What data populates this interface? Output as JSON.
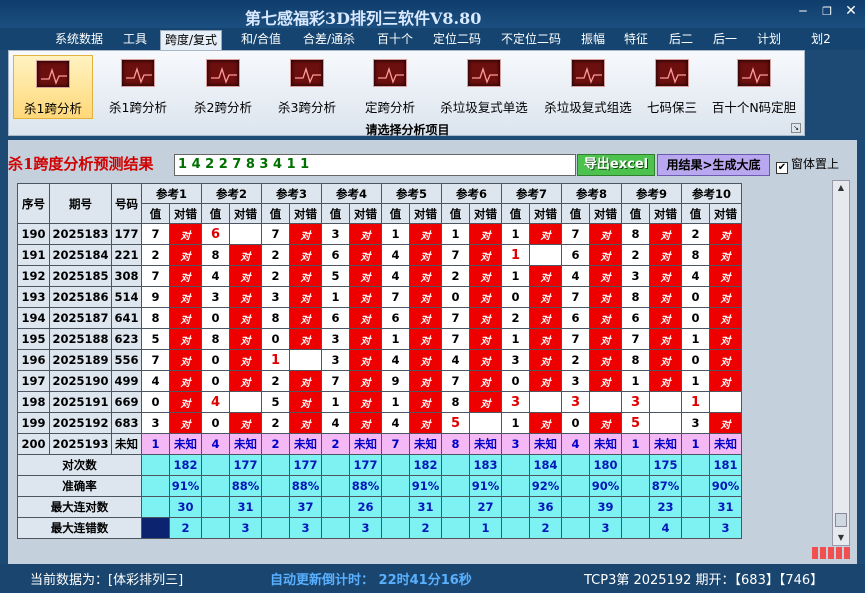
{
  "window": {
    "title": "第七感福彩3D排列三软件V8.80"
  },
  "menu": [
    "系统数据",
    "工具",
    "跨度/复式",
    "和/合值",
    "合差/通杀",
    "百十个",
    "定位二码",
    "不定位二码",
    "振幅",
    "特征",
    "后二",
    "后一",
    "计划",
    "划2"
  ],
  "menu_active_index": 2,
  "ribbon": {
    "items": [
      "杀1跨分析",
      "杀1跨分析",
      "杀2跨分析",
      "杀3跨分析",
      "定跨分析",
      "杀垃圾复式单选",
      "杀垃圾复式组选",
      "七码保三",
      "百十个N码定胆"
    ],
    "selected_index": 0,
    "caption": "请选择分析项目"
  },
  "result": {
    "heading": "杀1跨度分析预测结果",
    "values": "1 4 2 2 7 8 3 4 1 1",
    "excel_button": "导出excel",
    "generate_button": "用结果>生成大底",
    "topmost_label": "窗体置上",
    "topmost_checked": true
  },
  "table": {
    "col_headers": [
      "序号",
      "期号",
      "号码"
    ],
    "ref_headers": [
      "参考1",
      "参考2",
      "参考3",
      "参考4",
      "参考5",
      "参考6",
      "参考7",
      "参考8",
      "参考9",
      "参考10"
    ],
    "sub_headers": [
      "值",
      "对错"
    ],
    "rows": [
      {
        "seq": "190",
        "period": "2025183",
        "num": "177",
        "vals": [
          "7",
          "6",
          "7",
          "3",
          "1",
          "1",
          "1",
          "7",
          "8",
          "2"
        ],
        "hits": [
          1,
          0,
          1,
          1,
          1,
          1,
          1,
          1,
          1,
          1
        ]
      },
      {
        "seq": "191",
        "period": "2025184",
        "num": "221",
        "vals": [
          "2",
          "8",
          "2",
          "6",
          "4",
          "7",
          "1",
          "6",
          "2",
          "8"
        ],
        "hits": [
          1,
          1,
          1,
          1,
          1,
          1,
          0,
          1,
          1,
          1
        ]
      },
      {
        "seq": "192",
        "period": "2025185",
        "num": "308",
        "vals": [
          "7",
          "4",
          "2",
          "5",
          "4",
          "2",
          "1",
          "4",
          "3",
          "4"
        ],
        "hits": [
          1,
          1,
          1,
          1,
          1,
          1,
          1,
          1,
          1,
          1
        ]
      },
      {
        "seq": "193",
        "period": "2025186",
        "num": "514",
        "vals": [
          "9",
          "3",
          "3",
          "1",
          "7",
          "0",
          "0",
          "7",
          "8",
          "0"
        ],
        "hits": [
          1,
          1,
          1,
          1,
          1,
          1,
          1,
          1,
          1,
          1
        ]
      },
      {
        "seq": "194",
        "period": "2025187",
        "num": "641",
        "vals": [
          "8",
          "0",
          "8",
          "6",
          "6",
          "7",
          "2",
          "6",
          "6",
          "0"
        ],
        "hits": [
          1,
          1,
          1,
          1,
          1,
          1,
          1,
          1,
          1,
          1
        ]
      },
      {
        "seq": "195",
        "period": "2025188",
        "num": "623",
        "vals": [
          "5",
          "8",
          "0",
          "3",
          "1",
          "7",
          "1",
          "7",
          "7",
          "1"
        ],
        "hits": [
          1,
          1,
          1,
          1,
          1,
          1,
          1,
          1,
          1,
          1
        ]
      },
      {
        "seq": "196",
        "period": "2025189",
        "num": "556",
        "vals": [
          "7",
          "0",
          "1",
          "3",
          "4",
          "4",
          "3",
          "2",
          "8",
          "0"
        ],
        "hits": [
          1,
          1,
          0,
          1,
          1,
          1,
          1,
          1,
          1,
          1
        ]
      },
      {
        "seq": "197",
        "period": "2025190",
        "num": "499",
        "vals": [
          "4",
          "0",
          "2",
          "7",
          "9",
          "7",
          "0",
          "3",
          "1",
          "1"
        ],
        "hits": [
          1,
          1,
          1,
          1,
          1,
          1,
          1,
          1,
          1,
          1
        ]
      },
      {
        "seq": "198",
        "period": "2025191",
        "num": "669",
        "vals": [
          "0",
          "4",
          "5",
          "1",
          "1",
          "8",
          "3",
          "3",
          "3",
          "1"
        ],
        "hits": [
          1,
          0,
          1,
          1,
          1,
          1,
          0,
          0,
          0,
          0
        ]
      },
      {
        "seq": "199",
        "period": "2025192",
        "num": "683",
        "vals": [
          "3",
          "0",
          "2",
          "4",
          "4",
          "5",
          "1",
          "0",
          "5",
          "3"
        ],
        "hits": [
          1,
          1,
          1,
          1,
          1,
          0,
          1,
          1,
          0,
          1
        ]
      }
    ],
    "hit_text": "对",
    "unknown_row": {
      "seq": "200",
      "period": "2025193",
      "num": "未知",
      "vals": [
        "1",
        "4",
        "2",
        "2",
        "7",
        "8",
        "3",
        "4",
        "1",
        "1"
      ],
      "tag": "未知"
    },
    "stats": [
      {
        "label": "对次数",
        "values": [
          "182",
          "177",
          "177",
          "177",
          "182",
          "183",
          "184",
          "180",
          "175",
          "181"
        ]
      },
      {
        "label": "准确率",
        "values": [
          "91%",
          "88%",
          "88%",
          "88%",
          "91%",
          "91%",
          "92%",
          "90%",
          "87%",
          "90%"
        ]
      },
      {
        "label": "最大连对数",
        "values": [
          "30",
          "31",
          "37",
          "26",
          "31",
          "27",
          "36",
          "39",
          "23",
          "31"
        ]
      },
      {
        "label": "最大连错数",
        "values": [
          "2",
          "3",
          "3",
          "3",
          "2",
          "1",
          "2",
          "3",
          "4",
          "3"
        ]
      }
    ]
  },
  "status": {
    "current_data": "当前数据为：[体彩排列三]",
    "countdown": "自动更新倒计时： 22时41分16秒",
    "latest": "TCP3第 2025192 期开：【683】【746】"
  }
}
